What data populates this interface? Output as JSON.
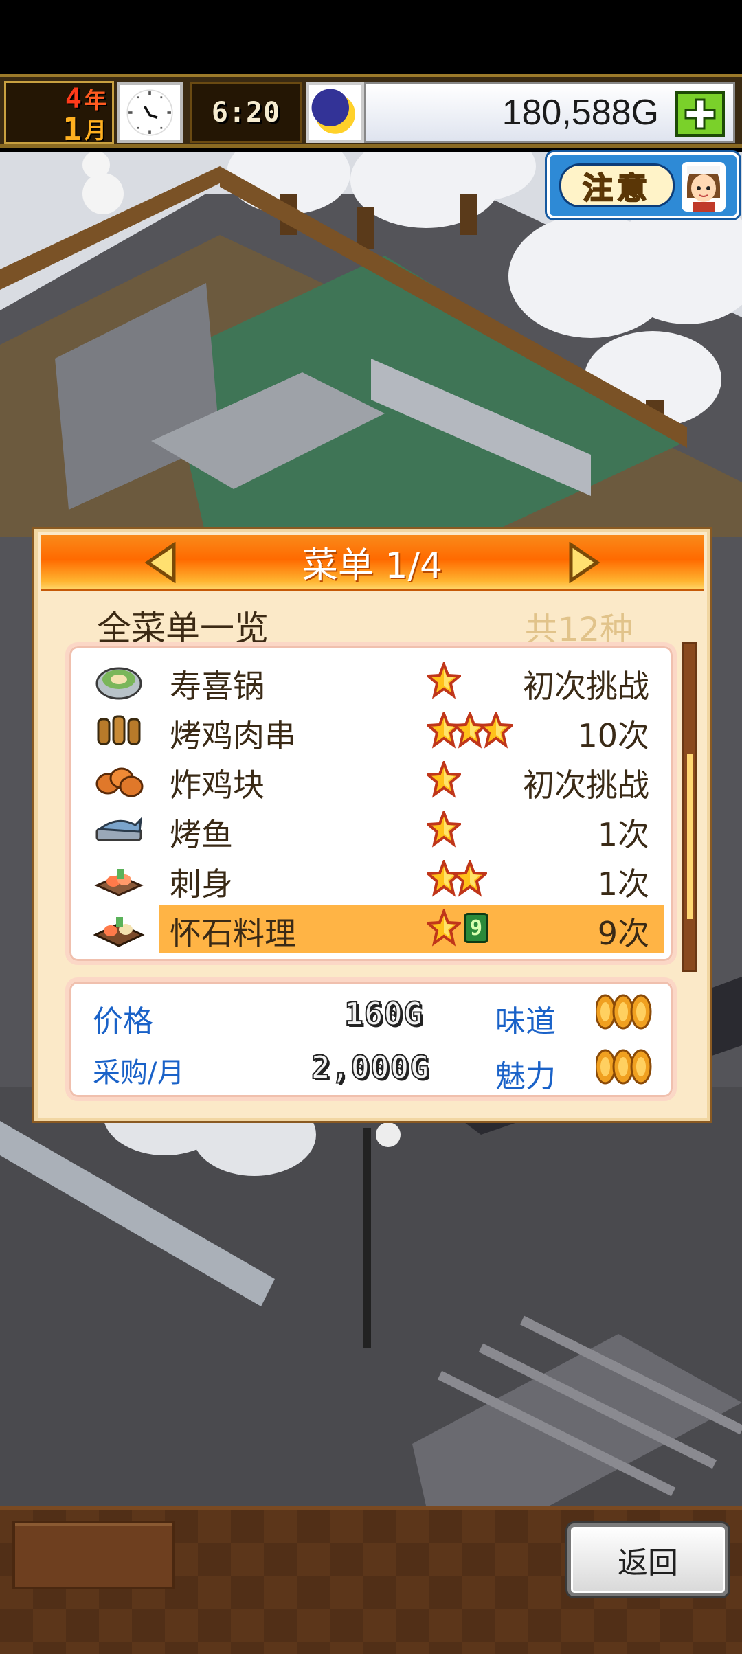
{
  "hud": {
    "year_num": "4",
    "year_unit": "年",
    "month_num": "1",
    "month_unit": "月",
    "time": "6:20",
    "money": "180,588G"
  },
  "alert": {
    "label": "注意"
  },
  "menu": {
    "title": "菜单 1/4",
    "subtitle": "全菜单一览",
    "total": "共12种",
    "items": [
      {
        "name": "寿喜锅",
        "stars": 1,
        "level": "",
        "count": "初次挑战",
        "icon": "hotpot-icon"
      },
      {
        "name": "烤鸡肉串",
        "stars": 3,
        "level": "",
        "count": "10次",
        "icon": "yakitori-icon"
      },
      {
        "name": "炸鸡块",
        "stars": 1,
        "level": "",
        "count": "初次挑战",
        "icon": "fried-chicken-icon"
      },
      {
        "name": "烤鱼",
        "stars": 1,
        "level": "",
        "count": "1次",
        "icon": "grilled-fish-icon"
      },
      {
        "name": "刺身",
        "stars": 2,
        "level": "",
        "count": "1次",
        "icon": "sashimi-icon"
      },
      {
        "name": "怀石料理",
        "stars": 1,
        "level": "9",
        "count": "9次",
        "icon": "kaiseki-icon",
        "selected": true
      }
    ],
    "details": {
      "price_label": "价格",
      "price_value": "160G",
      "purchase_label": "采购/月",
      "purchase_value": "2,000G",
      "taste_label": "味道",
      "taste_coins": 3,
      "appeal_label": "魅力",
      "appeal_coins": 3
    }
  },
  "bottom": {
    "back_label": "返回"
  },
  "colors": {
    "header_orange": "#ff6a00",
    "highlight": "#ffb445",
    "label_blue": "#1a62c8",
    "panel_bg": "#fbe9c8"
  }
}
